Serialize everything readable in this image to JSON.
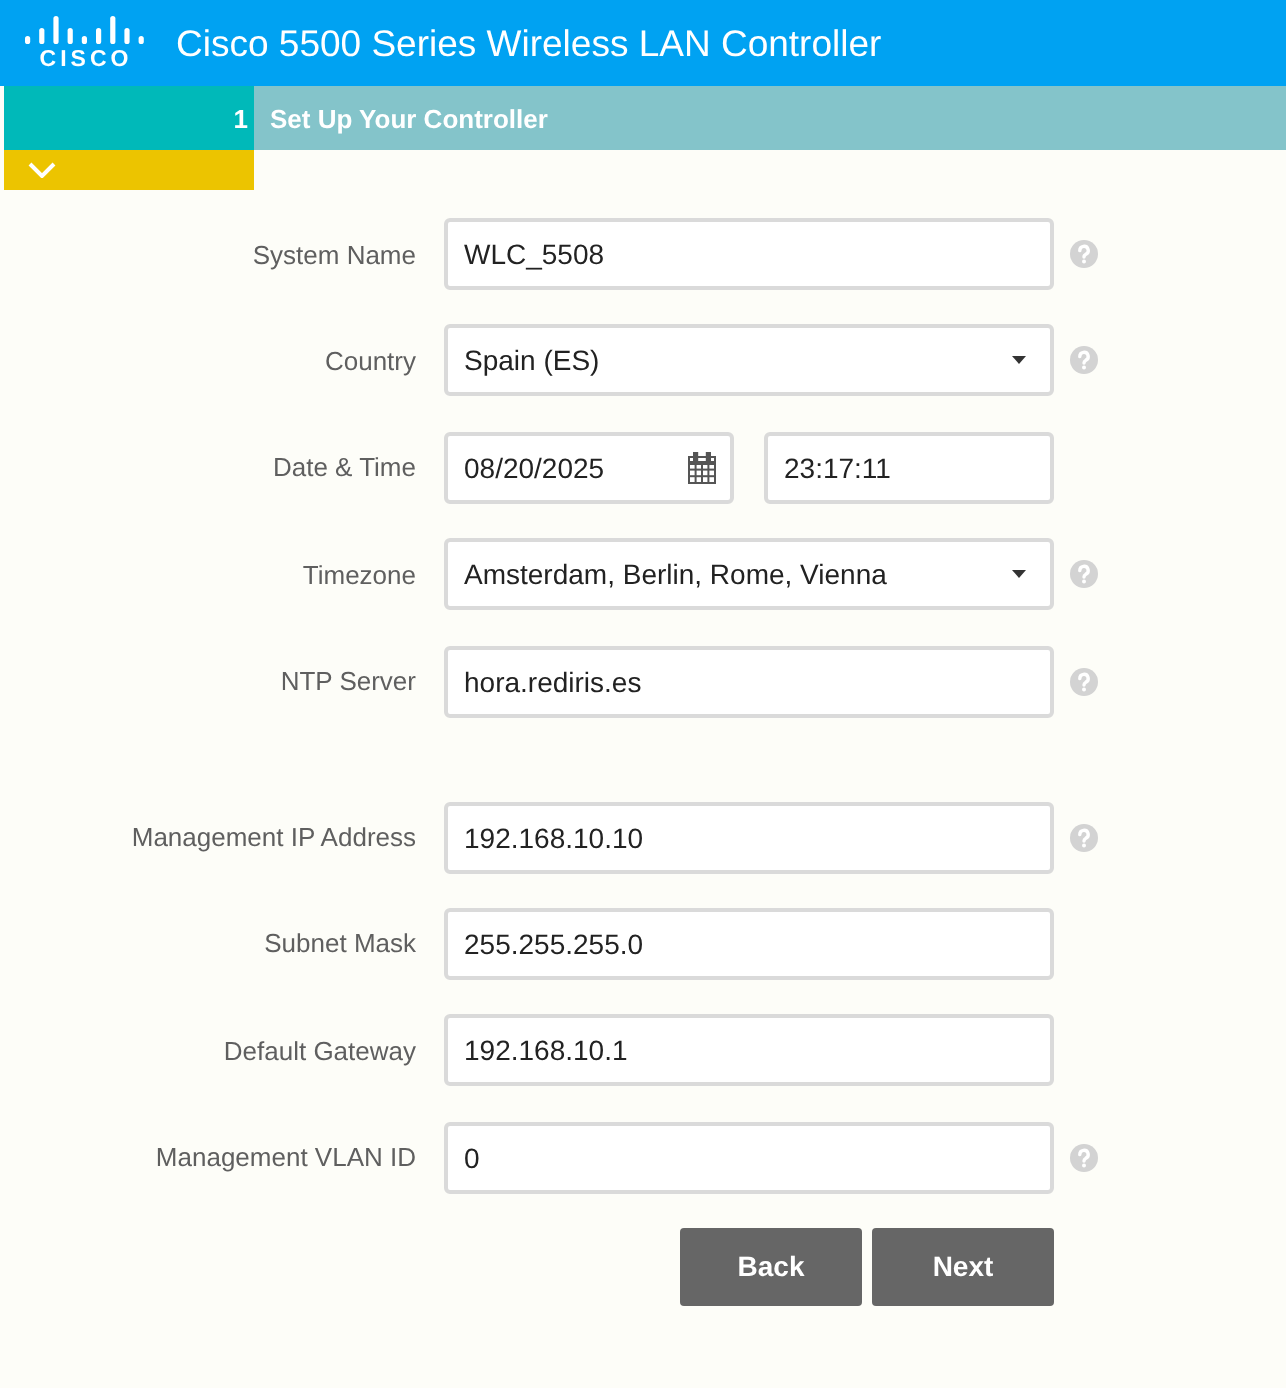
{
  "header": {
    "logo_text": "CISCO",
    "title": "Cisco 5500 Series Wireless LAN Controller"
  },
  "steps": [
    {
      "number": "1",
      "label": "Set Up Your Controller",
      "expanded": true
    }
  ],
  "form": {
    "sections": [
      {
        "fields": [
          {
            "kind": "text",
            "label": "System Name",
            "value": "WLC_5508",
            "help": true
          },
          {
            "kind": "select",
            "label": "Country",
            "value": "Spain (ES)",
            "help": true
          },
          {
            "kind": "datetime",
            "label": "Date & Time",
            "date": "08/20/2025",
            "time": "23:17:11",
            "help": false
          },
          {
            "kind": "select",
            "label": "Timezone",
            "value": "Amsterdam, Berlin, Rome, Vienna",
            "help": true
          },
          {
            "kind": "text",
            "label": "NTP Server",
            "value": "hora.rediris.es",
            "help": true
          }
        ]
      },
      {
        "fields": [
          {
            "kind": "text",
            "label": "Management IP Address",
            "value": "192.168.10.10",
            "help": true
          },
          {
            "kind": "text",
            "label": "Subnet Mask",
            "value": "255.255.255.0",
            "help": false
          },
          {
            "kind": "text",
            "label": "Default Gateway",
            "value": "192.168.10.1",
            "help": false
          },
          {
            "kind": "text",
            "label": "Management VLAN ID",
            "value": "0",
            "help": true
          }
        ]
      }
    ]
  },
  "buttons": [
    {
      "label": "Back"
    },
    {
      "label": "Next"
    }
  ]
}
